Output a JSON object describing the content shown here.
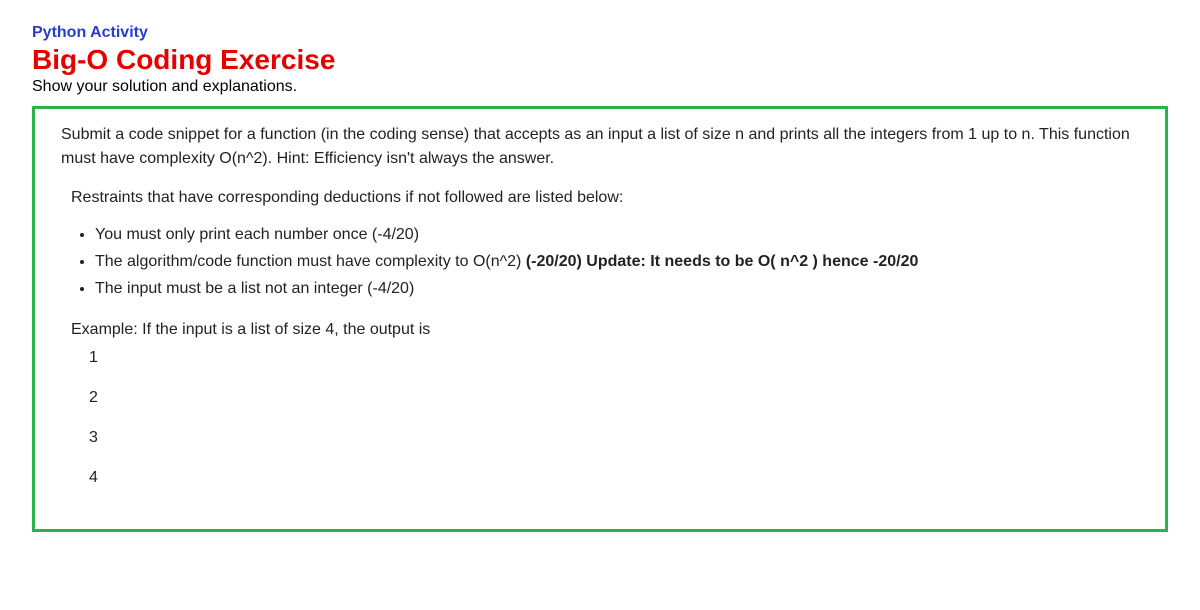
{
  "activity_label": "Python Activity",
  "exercise_title": "Big-O Coding Exercise",
  "instructions": "Show your solution and explanations.",
  "box": {
    "prompt": "Submit a code snippet for a function (in the coding sense) that accepts as an input a list of size n and prints all the integers from 1 up to n. This function must have complexity O(n^2). Hint: Efficiency isn't always the answer.",
    "restraints_intro": "Restraints that have corresponding deductions if not followed are listed below:",
    "restraints": [
      {
        "text": "You must only print each number once (-4/20)",
        "bold_suffix": ""
      },
      {
        "text": "The algorithm/code function must have complexity to O(n^2) ",
        "bold_suffix": "(-20/20) Update: It needs to be O( n^2 ) hence -20/20"
      },
      {
        "text": "The input must be a list not an integer (-4/20)",
        "bold_suffix": ""
      }
    ],
    "example_label": "Example: If the input is a list of size 4, the output is",
    "example_output": [
      "1",
      "2",
      "3",
      "4"
    ]
  }
}
